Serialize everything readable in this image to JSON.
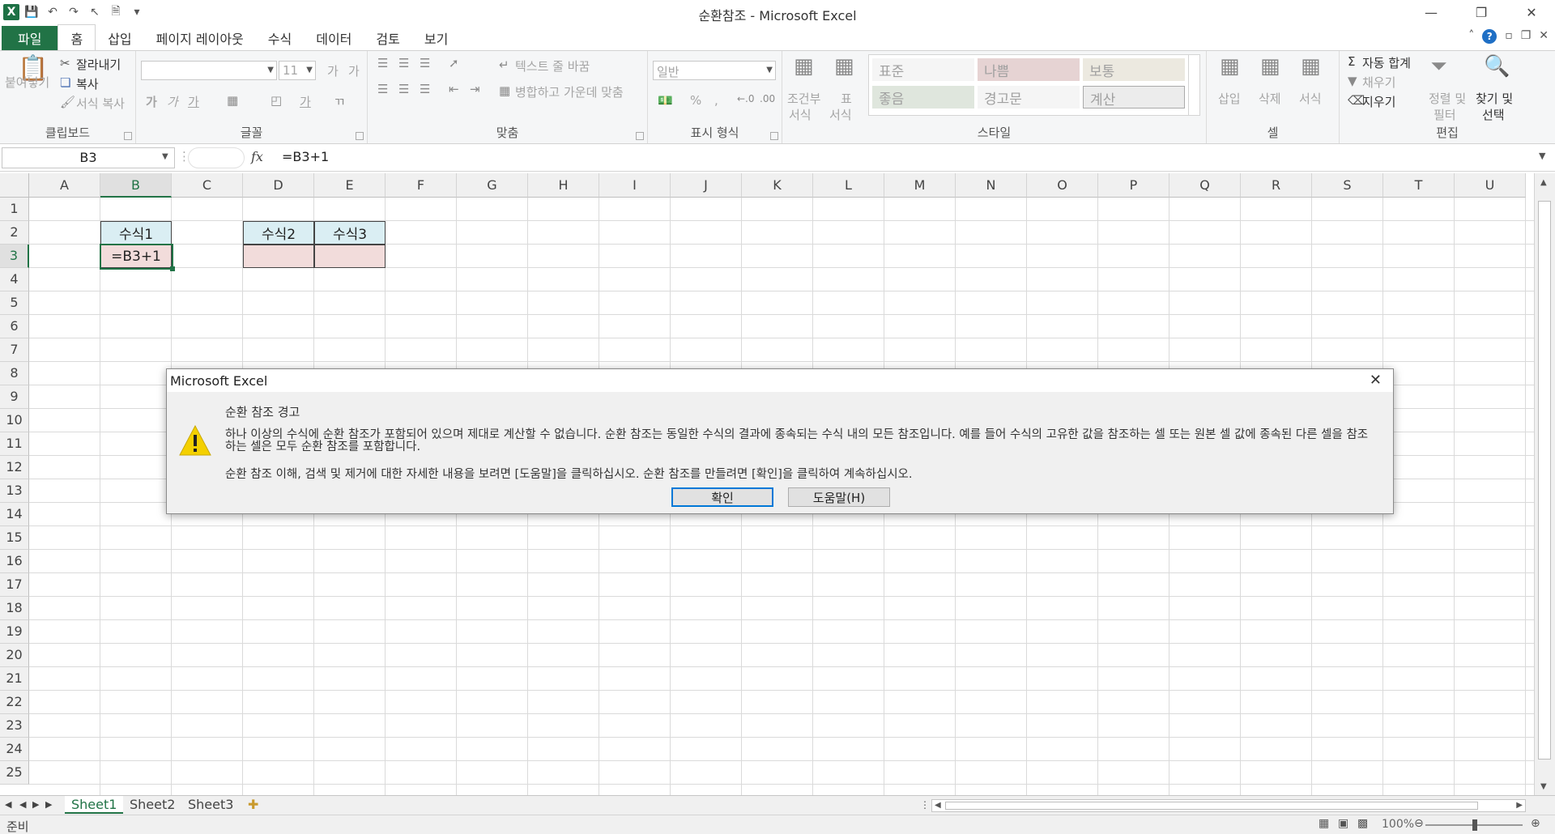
{
  "window": {
    "title": "순환참조 - Microsoft Excel"
  },
  "tabs": [
    {
      "label": "파일"
    },
    {
      "label": "홈"
    },
    {
      "label": "삽입"
    },
    {
      "label": "페이지 레이아웃"
    },
    {
      "label": "수식"
    },
    {
      "label": "데이터"
    },
    {
      "label": "검토"
    },
    {
      "label": "보기"
    }
  ],
  "ribbon": {
    "clipboard": {
      "paste": "붙여넣기",
      "cut": "잘라내기",
      "copy": "복사",
      "format_painter": "서식 복사",
      "title": "클립보드"
    },
    "font": {
      "size": "11",
      "bold": "가",
      "italic": "가",
      "underline": "가",
      "grow": "가",
      "shrink": "가",
      "fontcolor": "가",
      "title": "글꼴"
    },
    "align": {
      "wrap": "텍스트 줄 바꿈",
      "merge": "병합하고 가운데 맞춤",
      "title": "맞춤"
    },
    "number": {
      "format": "일반",
      "percent": "%",
      "comma": ",",
      "title": "표시 형식"
    },
    "styles": {
      "cond": "조건부",
      "cond2": "서식",
      "table": "표",
      "table2": "서식",
      "normal": "표준",
      "bad": "나쁨",
      "neutral": "보통",
      "good": "좋음",
      "warning": "경고문",
      "calc": "계산",
      "title": "스타일"
    },
    "cells": {
      "insert": "삽입",
      "delete": "삭제",
      "format": "서식",
      "title": "셀"
    },
    "edit": {
      "autosum": "자동 합계",
      "fill": "채우기",
      "clear": "지우기",
      "sort": "정렬 및",
      "sort2": "필터",
      "find": "찾기 및",
      "find2": "선택",
      "title": "편집"
    }
  },
  "formula_bar": {
    "name_box": "B3",
    "fx": "fx",
    "formula": "=B3+1"
  },
  "grid": {
    "columns": [
      "A",
      "B",
      "C",
      "D",
      "E",
      "F",
      "G",
      "H",
      "I",
      "J",
      "K",
      "L",
      "M",
      "N",
      "O",
      "P",
      "Q",
      "R",
      "S",
      "T",
      "U"
    ],
    "rows": [
      "1",
      "2",
      "3",
      "4",
      "5",
      "6",
      "7",
      "8",
      "9",
      "10",
      "11",
      "12",
      "13",
      "14",
      "15",
      "16",
      "17",
      "18",
      "19",
      "20",
      "21",
      "22",
      "23",
      "24",
      "25"
    ],
    "cells": {
      "b2": "수식1",
      "b3": "=B3+1",
      "d2": "수식2",
      "e2": "수식3"
    }
  },
  "sheets": [
    "Sheet1",
    "Sheet2",
    "Sheet3"
  ],
  "status": {
    "ready": "준비",
    "zoom": "100%"
  },
  "dialog": {
    "title": "Microsoft Excel",
    "heading": "순환 참조 경고",
    "message1": "하나 이상의 수식에 순환 참조가 포함되어 있으며 제대로 계산할 수 없습니다. 순환 참조는 동일한 수식의 결과에 종속되는 수식 내의 모든 참조입니다. 예를 들어 수식의 고유한 값을 참조하는 셀 또는 원본 셀 값에 종속된 다른 셀을 참조하는 셀은 모두 순환 참조를 포함합니다.",
    "message2": "순환 참조 이해, 검색 및 제거에 대한 자세한 내용을 보려면 [도움말]을 클릭하십시오. 순환 참조를 만들려면 [확인]을 클릭하여 계속하십시오.",
    "ok": "확인",
    "help": "도움말(H)"
  },
  "colors": {
    "accent": "#217346",
    "header_fill": "#daeef3",
    "pink_fill": "#f2dcdb"
  }
}
